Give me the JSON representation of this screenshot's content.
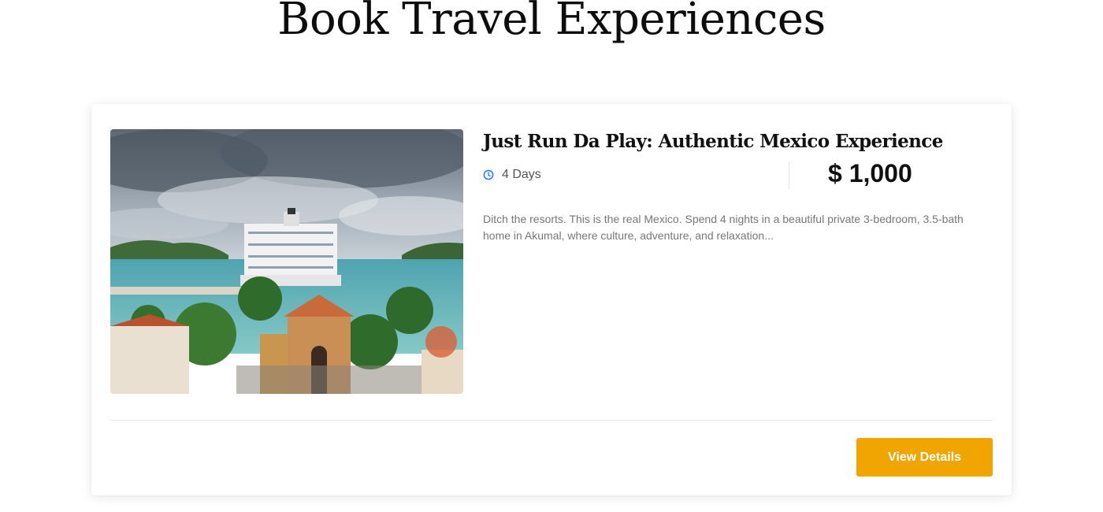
{
  "page": {
    "title": "Book Travel Experiences"
  },
  "listing": {
    "title": "Just Run Da Play: Authentic Mexico Experience",
    "duration": "4 Days",
    "price": "$ 1,000",
    "description": "Ditch the resorts. This is the real Mexico. Spend 4 nights in a beautiful private 3-bedroom, 3.5-bath home in Akumal, where culture, adventure, and relaxation...",
    "image_subject": "cruise ship docked at a tropical harbor with a church and palm trees",
    "duration_icon": "clock-icon",
    "button_label": "View Details"
  },
  "colors": {
    "accent": "#f0a500",
    "icon_blue": "#2d7ff9",
    "text_dark": "#111111",
    "text_muted": "#777777"
  }
}
